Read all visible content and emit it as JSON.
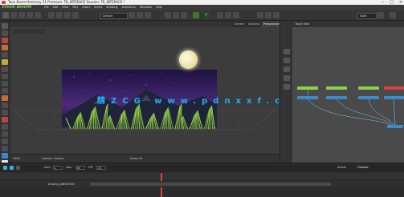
{
  "window": {
    "title": "Toon Boom Harmony 21 Premium: T8_INTERACE Session: T8_INTERACE *"
  },
  "menubar": {
    "logo": "TOON BOOM",
    "items": [
      "File",
      "Edit",
      "View",
      "Play",
      "Insert",
      "Scene",
      "Drawing",
      "Animation",
      "Windows",
      "Help"
    ]
  },
  "toolbar": {
    "dropdown1": "Default",
    "dropdown2": "Solid",
    "dropdown3": "Interface Color",
    "dropdown4": "2D Tool"
  },
  "viewer": {
    "tabs": [
      "Camera",
      "Drawing",
      "Perspective"
    ],
    "bottom_left": "100%",
    "bottom_status": "Camera: Camera",
    "frame_label": "Frame 20"
  },
  "node_view": {
    "tab": "Node View",
    "nodes": [
      "Drawing",
      "Drawing",
      "Drawing",
      "Drawing",
      "Drawing",
      "Drawing",
      "Drawing",
      "Composite"
    ]
  },
  "timeline": {
    "start_label": "Start",
    "start_value": "1",
    "stop_label": "Stop",
    "stop_value": "60",
    "fps_label": "FPS",
    "fps_value": "24",
    "track_label": "Drawing_ANIMATION",
    "tabs": [
      "Xsheet",
      "Timeline"
    ]
  },
  "watermark": "精ZCG www.pdnxxf.com",
  "colors": {
    "accent": "#9be16a",
    "watermark": "#28a7e6",
    "sky": "#2a1850",
    "grass": "#78b83a"
  }
}
